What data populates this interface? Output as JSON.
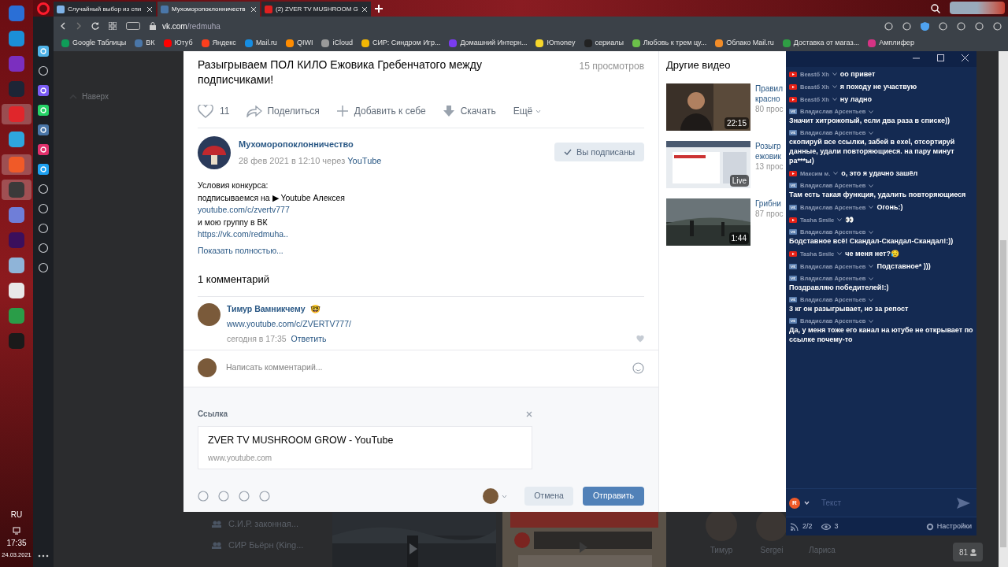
{
  "taskbar": {
    "apps": [
      {
        "color": "#2a6fd6",
        "selected": false
      },
      {
        "color": "#1b8fd8",
        "selected": false
      },
      {
        "color": "#7b2fbf",
        "selected": false
      },
      {
        "color": "#1d2536",
        "selected": false
      },
      {
        "color": "#e0262b",
        "selected": true
      },
      {
        "color": "#2ea6de",
        "selected": false
      },
      {
        "color": "#f05a28",
        "selected": true
      },
      {
        "color": "#3a3a3a",
        "selected": true
      },
      {
        "color": "#6f7ed8",
        "selected": false
      },
      {
        "color": "#3b0f5c",
        "selected": false
      },
      {
        "color": "#8fb4d8",
        "selected": false
      },
      {
        "color": "#e8e8e8",
        "selected": false
      },
      {
        "color": "#2a9d48",
        "selected": false
      },
      {
        "color": "#1a1a1a",
        "selected": false
      }
    ],
    "language": "RU",
    "time": "17:35",
    "date": "24.03.2021"
  },
  "browser": {
    "tabs": [
      {
        "title": "Случайный выбор из спи",
        "selected": false
      },
      {
        "title": "Мухоморопоклонничеств",
        "selected": true
      },
      {
        "title": "(2) ZVER TV MUSHROOM G",
        "selected": false
      }
    ],
    "address": {
      "domain": "vk.com",
      "path": "/redmuha"
    },
    "bookmarks": [
      {
        "label": "Google Таблицы",
        "color": "#0f9d58"
      },
      {
        "label": "ВК",
        "color": "#4a76a8"
      },
      {
        "label": "Ютуб",
        "color": "#ff0000"
      },
      {
        "label": "Яндекс",
        "color": "#fc3f1d"
      },
      {
        "label": "Mail.ru",
        "color": "#168de2"
      },
      {
        "label": "QIWI",
        "color": "#ff8c00"
      },
      {
        "label": "iCloud",
        "color": "#9a9a9a"
      },
      {
        "label": "СИР: Синдром Игр...",
        "color": "#f2b705"
      },
      {
        "label": "Домашний Интерн...",
        "color": "#7a3cf0"
      },
      {
        "label": "Юmoney",
        "color": "#f7d72b"
      },
      {
        "label": "сериалы",
        "color": "#222222"
      },
      {
        "label": "Любовь к трем цу...",
        "color": "#6cc04a"
      },
      {
        "label": "Облако Mail.ru",
        "color": "#f28c28"
      },
      {
        "label": "Доставка от магаз...",
        "color": "#2f9e44"
      },
      {
        "label": "Амплифер",
        "color": "#d63384"
      }
    ]
  },
  "page_background": {
    "back_to_top": "Наверх",
    "groups": [
      "С.И.Р. законная...",
      "СИР Бьёрн (King..."
    ],
    "friends": [
      "Тимур",
      "Sergei",
      "Лариса"
    ],
    "online_count": "81"
  },
  "video_modal": {
    "title": "Разыгрываем ПОЛ КИЛО Ежовика Гребенчатого между подписчиками!",
    "views": "15 просмотров",
    "likes": "11",
    "share": "Поделиться",
    "add": "Добавить к себе",
    "download": "Скачать",
    "more": "Ещё",
    "author": "Мухоморопоклонничество",
    "date": "28 фев 2021 в 12:10 через",
    "via": "YouTube",
    "subscribed": "Вы подписаны",
    "description": [
      {
        "kind": "text",
        "text": "Условия конкурса:"
      },
      {
        "kind": "text",
        "text": "подписываемся на ▶ Youtube Алексея"
      },
      {
        "kind": "link",
        "text": "youtube.com/c/zvertv777"
      },
      {
        "kind": "text",
        "text": "и мою группу в ВК"
      },
      {
        "kind": "link",
        "text": "https://vk.com/redmuha.."
      }
    ],
    "show_more": "Показать полностью...",
    "comments_header": "1 комментарий",
    "comments": [
      {
        "author": "Тимур Вамникчему",
        "emoji": "🤓",
        "text": "www.youtube.com/c/ZVERTV777/",
        "time": "сегодня в 17:35",
        "reply": "Ответить"
      }
    ],
    "comment_field": {
      "placeholder": "Написать комментарий..."
    },
    "link_attachment": {
      "label": "Ссылка",
      "title": "ZVER TV MUSHROOM GROW - YouTube",
      "domain": "www.youtube.com"
    },
    "cancel": "Отмена",
    "send": "Отправить",
    "other_videos": {
      "title": "Другие видео",
      "items": [
        {
          "lines": [
            "Правил",
            "красно",
            "80 прос"
          ],
          "duration": "22:15"
        },
        {
          "lines": [
            "Розыгр",
            "ежовик",
            "13 прос"
          ],
          "duration": "Live"
        },
        {
          "lines": [
            "Грибни",
            "87 прос"
          ],
          "duration": "1:44"
        }
      ]
    }
  },
  "chat": {
    "messages": [
      {
        "kind": "youtube",
        "author": "Beastб Xh",
        "text": "оо привет"
      },
      {
        "kind": "youtube",
        "author": "Beastб Xh",
        "text": "я походу не участвую"
      },
      {
        "kind": "youtube",
        "author": "Beastб Xh",
        "text": "ну ладно"
      },
      {
        "kind": "vk",
        "author": "Владислав Арсентьев",
        "text": "Значит хитрожопый, если два раза в списке))"
      },
      {
        "kind": "vk",
        "author": "Владислав Арсентьев",
        "text": "скопируй все ссылки, забей в exel, отсортируй данные, удали повторяющиеся. на пару минут ра***ы)"
      },
      {
        "kind": "youtube",
        "author": "Максим м.",
        "text": "о, это я удачно зашёл"
      },
      {
        "kind": "vk",
        "author": "Владислав Арсентьев",
        "text": "Там есть такая функция, удалить повторяющиеся"
      },
      {
        "kind": "vk",
        "author": "Владислав Арсентьев",
        "text": "Огонь:)"
      },
      {
        "kind": "youtube",
        "author": "Tasha Smile",
        "text": "👀"
      },
      {
        "kind": "vk",
        "author": "Владислав Арсентьев",
        "text": "Бодставное всё! Скандал-Скандал-Скандал!:))"
      },
      {
        "kind": "youtube",
        "author": "Tasha Smile",
        "text": "че меня нет?😥"
      },
      {
        "kind": "vk",
        "author": "Владислав Арсентьев",
        "text": "Подставное* )))"
      },
      {
        "kind": "vk",
        "author": "Владислав Арсентьев",
        "text": "Поздравляю победителей!:)"
      },
      {
        "kind": "vk",
        "author": "Владислав Арсентьев",
        "text": "3 кг он разыгрывает, но за репост"
      },
      {
        "kind": "vk",
        "author": "Владислав Арсентьев",
        "text": "Да, у меня тоже его канал на ютубе не открывает по ссылке почему-то"
      }
    ],
    "input": {
      "placeholder": "Текст"
    },
    "account_letter": "R",
    "streams": "2/2",
    "viewers": "3",
    "settings": "Настройки"
  }
}
